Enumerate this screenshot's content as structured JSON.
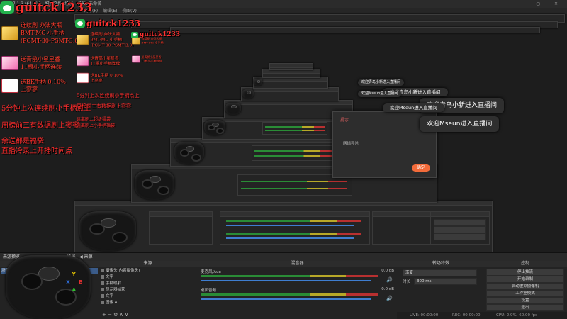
{
  "window": {
    "title": "27.1.3 (64-bit) - 配置文件: 场景 - 场景: 未命名",
    "controls": "— ▢ ✕"
  },
  "brand": {
    "name": "guitck1233",
    "icon": "wechat-icon"
  },
  "menu": [
    "文件(F)",
    "编辑(E)",
    "视图(V)",
    "停靠窗口(D)",
    "配置文件(P)",
    "场景集合(S)",
    "工具(T)",
    "帮助(H)"
  ],
  "gifts": [
    {
      "line1": "连续刷 办法大瓶",
      "line2": "BMT-MC 小手柄",
      "line3": "(PCMT-30-PSMT-3.0)",
      "style": "gold",
      "icon": "gift-icon"
    },
    {
      "line1": "送青鹊小星星香",
      "line2": "11根小手柄连续",
      "style": "pink",
      "icon": "gift-icon"
    },
    {
      "line1": "送BK手柄 0.10%",
      "line2": "上寥寥",
      "style": "red",
      "icon": "gift-icon"
    }
  ],
  "overlay_text": {
    "line1": "5分钟上次连续刷小手柄点上",
    "line2": "周榜前三有数据刷上寥寥",
    "line3": "余送都是福袋",
    "line4": "直播冷录上开播时间点",
    "small1": "远离刷上超级福袋",
    "small2": "远离刷上小手柄福袋"
  },
  "toasts": {
    "t1": "欢迎青鸟小新进入直播间",
    "t2": "欢迎Mseun进入直播间",
    "t3": "欢迎青岛小新进入直播间",
    "t4": "欢迎Mseun进入直播间",
    "t5": "欢迎青岛小新进入直播间",
    "t6": "欢迎Mseun进入直播间"
  },
  "popup": {
    "title": "提示",
    "body": "网络异常",
    "ok": "确定"
  },
  "docks": {
    "preview_header": "来源预览",
    "preview_tabs": [
      "▶ 场景",
      "◀ 来源"
    ],
    "scenes": {
      "title": "场景",
      "items": [
        "场景"
      ]
    },
    "sources": {
      "title": "来源",
      "items": [
        "摄像头(内置摄像头)",
        "文字",
        "手柄映射",
        "显示器捕获",
        "文字",
        "图像 4"
      ]
    },
    "mixer": {
      "title": "混音器",
      "channels": [
        {
          "name": "麦克风/Aux",
          "db": "0.0 dB"
        },
        {
          "name": "桌面音频",
          "db": "0.0 dB"
        }
      ]
    },
    "transitions": {
      "title": "转场特效",
      "mode": "渐变",
      "duration_label": "时长",
      "duration": "300 ms"
    },
    "controls": {
      "title": "控制",
      "buttons": [
        "停止推流",
        "开始录制",
        "启动虚拟摄像机",
        "工作室模式",
        "设置",
        "退出"
      ]
    }
  },
  "statusbar": {
    "live": "LIVE: 00:00:00",
    "rec": "REC: 00:00:00",
    "cpu": "CPU: 2.9%, 60.00 fps"
  },
  "colors": {
    "accent": "#ff3030",
    "brand_green": "#22b14c",
    "popup_button": "#f26b3a"
  }
}
